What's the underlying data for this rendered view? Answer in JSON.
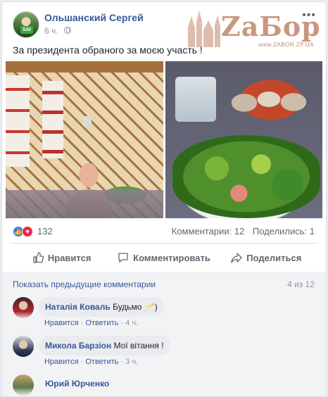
{
  "post": {
    "author": "Ольшанский Сергей",
    "avatar_badge": "SAI",
    "time": "6 ч.",
    "more": "•••",
    "text": "За президента обраного за моєю участь !"
  },
  "watermark": {
    "brand": "ZaБор",
    "site": "www.ZABOR.ZP.UA"
  },
  "reactions": {
    "count": "132",
    "comments": "Комментарии: 12",
    "shares": "Поделились: 1"
  },
  "actions": {
    "like": "Нравится",
    "comment": "Комментировать",
    "share": "Поделиться"
  },
  "comments_section": {
    "show_previous": "Показать предыдущие комментарии",
    "paging": "4 из 12",
    "items": [
      {
        "name": "Наталія Коваль",
        "text": "Будьмо 🥂)",
        "like": "Нравится",
        "reply": "Ответить",
        "time": "4 ч."
      },
      {
        "name": "Микола Барзіон",
        "text": "Мої вітання !",
        "like": "Нравится",
        "reply": "Ответить",
        "time": "3 ч."
      },
      {
        "name": "Юрий Юрченко",
        "text": ""
      }
    ]
  },
  "colors": {
    "link": "#385898",
    "like_blue": "#4a76e8",
    "love_red": "#f0284a"
  }
}
